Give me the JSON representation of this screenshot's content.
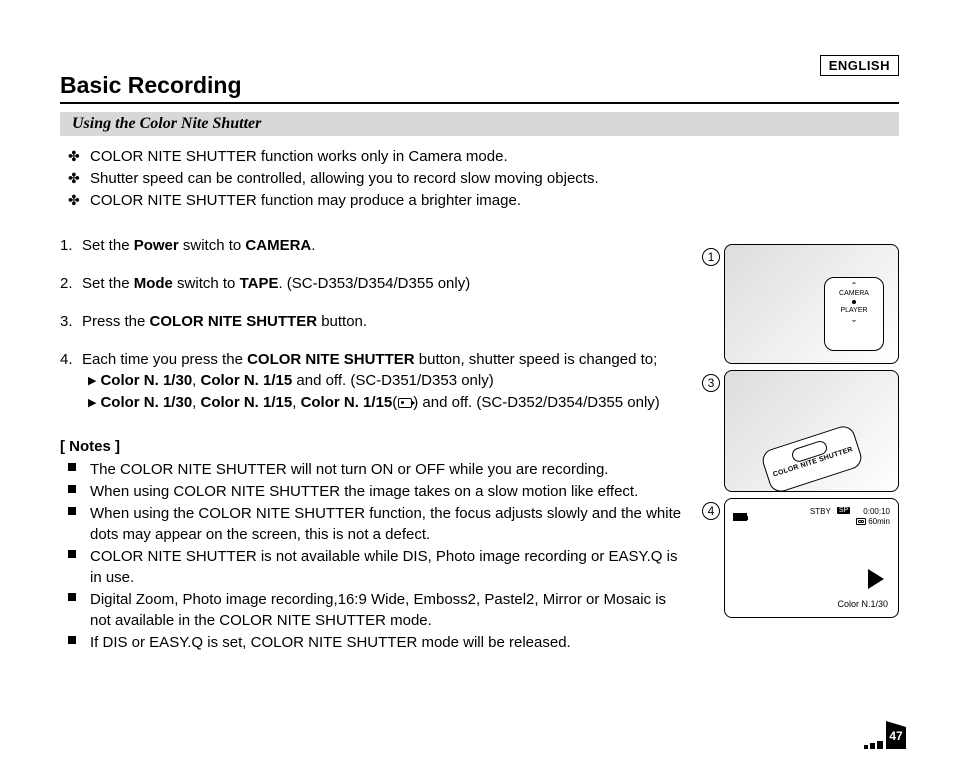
{
  "meta": {
    "language_tag": "ENGLISH",
    "page_number": "47"
  },
  "page_title": "Basic Recording",
  "section_heading": "Using the Color Nite Shutter",
  "intro": [
    "COLOR NITE SHUTTER function works only in Camera mode.",
    "Shutter speed can be controlled, allowing you to record slow moving objects.",
    "COLOR NITE SHUTTER function may produce a brighter image."
  ],
  "steps": {
    "s1": {
      "prefix": "Set the ",
      "b1": "Power",
      "mid": " switch to ",
      "b2": "CAMERA",
      "suffix": "."
    },
    "s2": {
      "prefix": "Set the ",
      "b1": "Mode",
      "mid": " switch to ",
      "b2": "TAPE",
      "suffix": ". (SC-D353/D354/D355 only)"
    },
    "s3": {
      "prefix": "Press the ",
      "b1": "COLOR NITE SHUTTER",
      "suffix": " button."
    },
    "s4": {
      "prefix": "Each time you press the ",
      "b1": "COLOR NITE SHUTTER",
      "suffix": " button, shutter speed is changed to;"
    },
    "s4a": {
      "a": "Color N. 1/30",
      "b": "Color N. 1/15",
      "suffix": " and off. (SC-D351/D353 only)"
    },
    "s4b": {
      "a": "Color N. 1/30",
      "b": "Color N. 1/15",
      "c": "Color N. 1/15",
      "suffix": ") and off. (SC-D352/D354/D355 only)"
    }
  },
  "notes_heading": "[ Notes ]",
  "notes": [
    "The COLOR NITE SHUTTER will not turn ON or OFF while you are recording.",
    "When using COLOR NITE SHUTTER the image takes on a slow motion like effect.",
    "When using the COLOR NITE SHUTTER function, the focus adjusts slowly and the white dots may appear on the screen, this is not a defect.",
    "COLOR NITE SHUTTER is not available while DIS, Photo image recording or EASY.Q is in use.",
    "Digital Zoom, Photo image recording,16:9 Wide, Emboss2, Pastel2, Mirror or Mosaic is not available in the COLOR NITE SHUTTER mode.",
    "If DIS or EASY.Q is set, COLOR NITE SHUTTER mode will be released."
  ],
  "figures": {
    "f1": {
      "marker": "1",
      "label_camera": "CAMERA",
      "label_player": "PLAYER"
    },
    "f3": {
      "marker": "3",
      "button_label": "COLOR NITE SHUTTER"
    },
    "f4": {
      "marker": "4",
      "status": "STBY",
      "speed": "SP",
      "timecode": "0:00:10",
      "remain": "60min",
      "mode_label": "Color N.1/30"
    }
  }
}
